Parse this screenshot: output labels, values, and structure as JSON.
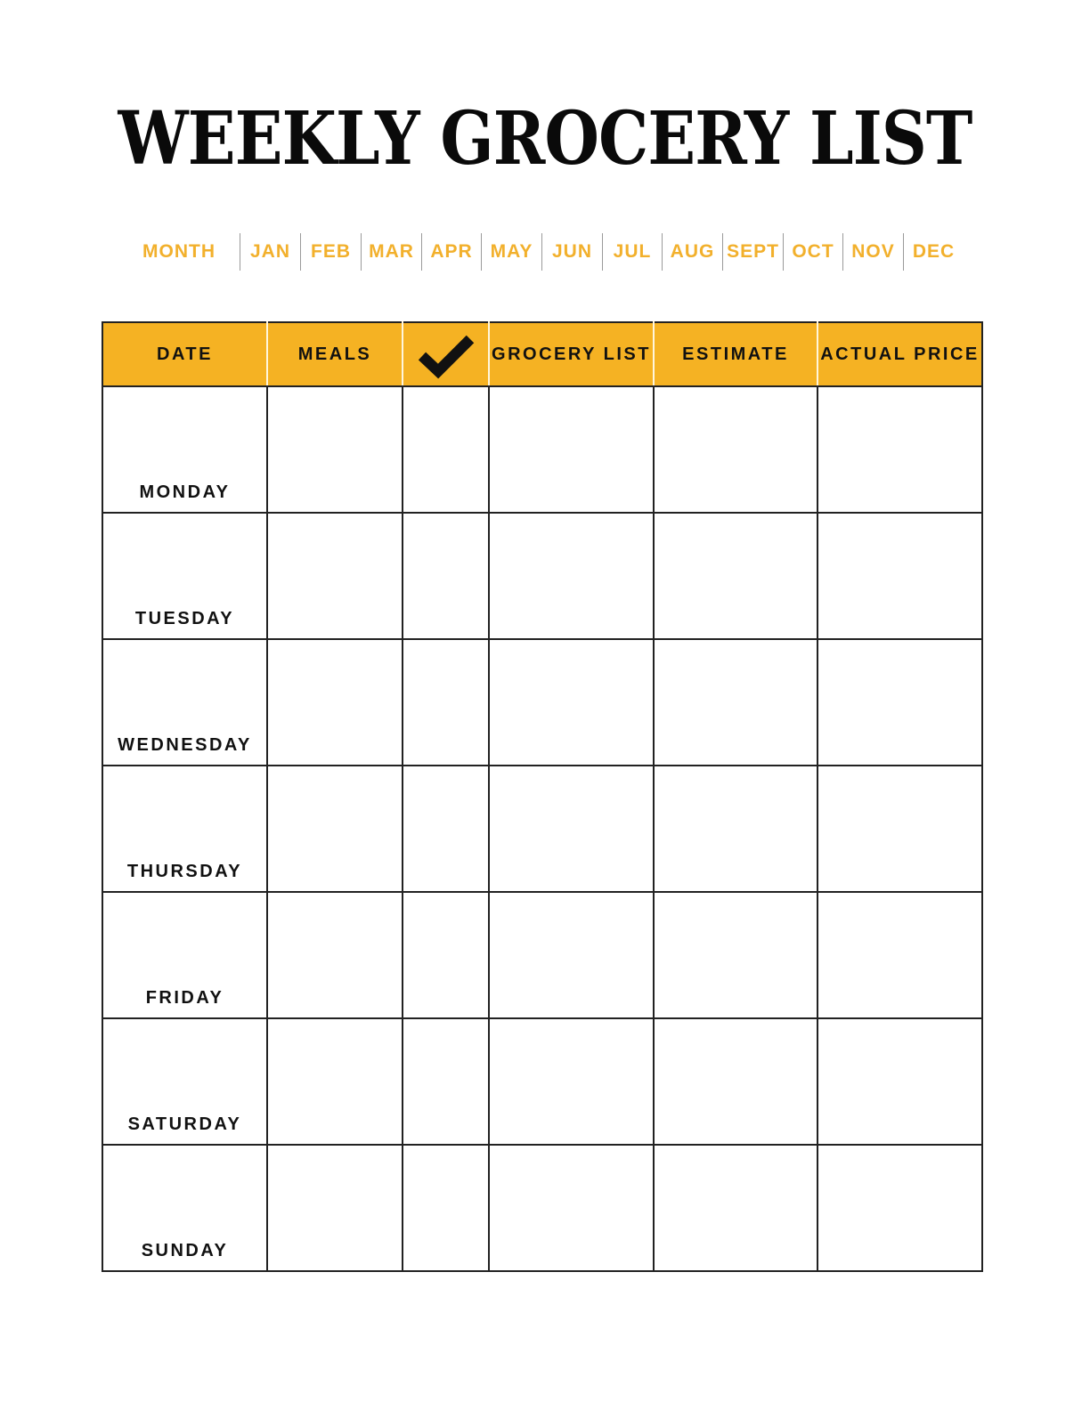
{
  "title": "WEEKLY GROCERY LIST",
  "month_selector": {
    "label": "MONTH",
    "months": [
      "JAN",
      "FEB",
      "MAR",
      "APR",
      "MAY",
      "JUN",
      "JUL",
      "AUG",
      "SEPT",
      "OCT",
      "NOV",
      "DEC"
    ]
  },
  "table": {
    "headers": {
      "date": "DATE",
      "meals": "MEALS",
      "check_icon": "checkmark-icon",
      "grocery_list": "GROCERY LIST",
      "estimate": "ESTIMATE",
      "actual_price": "ACTUAL PRICE"
    },
    "rows": [
      {
        "day": "MONDAY",
        "meals": "",
        "checked": "",
        "grocery_list": "",
        "estimate": "",
        "actual_price": ""
      },
      {
        "day": "TUESDAY",
        "meals": "",
        "checked": "",
        "grocery_list": "",
        "estimate": "",
        "actual_price": ""
      },
      {
        "day": "WEDNESDAY",
        "meals": "",
        "checked": "",
        "grocery_list": "",
        "estimate": "",
        "actual_price": ""
      },
      {
        "day": "THURSDAY",
        "meals": "",
        "checked": "",
        "grocery_list": "",
        "estimate": "",
        "actual_price": ""
      },
      {
        "day": "FRIDAY",
        "meals": "",
        "checked": "",
        "grocery_list": "",
        "estimate": "",
        "actual_price": ""
      },
      {
        "day": "SATURDAY",
        "meals": "",
        "checked": "",
        "grocery_list": "",
        "estimate": "",
        "actual_price": ""
      },
      {
        "day": "SUNDAY",
        "meals": "",
        "checked": "",
        "grocery_list": "",
        "estimate": "",
        "actual_price": ""
      }
    ]
  },
  "colors": {
    "accent": "#f5b223",
    "month_text": "#f2b02c",
    "text": "#111111"
  }
}
